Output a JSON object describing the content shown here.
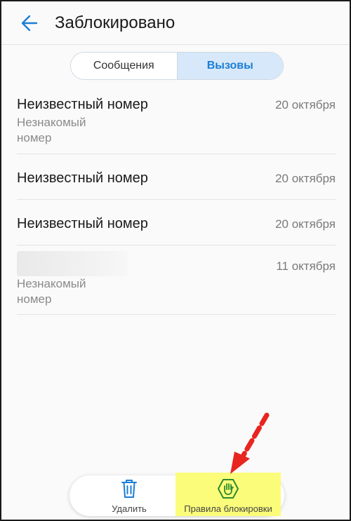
{
  "appbar": {
    "back_icon": "arrow-left-icon",
    "title": "Заблокировано"
  },
  "tabs": [
    {
      "label": "Сообщения",
      "active": false
    },
    {
      "label": "Вызовы",
      "active": true
    }
  ],
  "calls": [
    {
      "name": "Неизвестный номер",
      "subtitle": "Незнакомый номер",
      "date": "20 октября"
    },
    {
      "name": "Неизвестный номер",
      "subtitle": "",
      "date": "20 октября"
    },
    {
      "name": "Неизвестный номер",
      "subtitle": "",
      "date": "20 октября"
    },
    {
      "name": "",
      "name_blurred": true,
      "subtitle": "Незнакомый номер",
      "date": "11 октября"
    }
  ],
  "bottom_actions": {
    "delete_label": "Удалить",
    "delete_icon": "trash-icon",
    "rules_label": "Правила блокировки",
    "rules_icon": "block-hand-icon"
  },
  "colors": {
    "accent": "#1b7ed6",
    "rules_icon": "#2e8b2e",
    "highlight": "#fbfd7a",
    "annotation_arrow": "#e8251f"
  }
}
